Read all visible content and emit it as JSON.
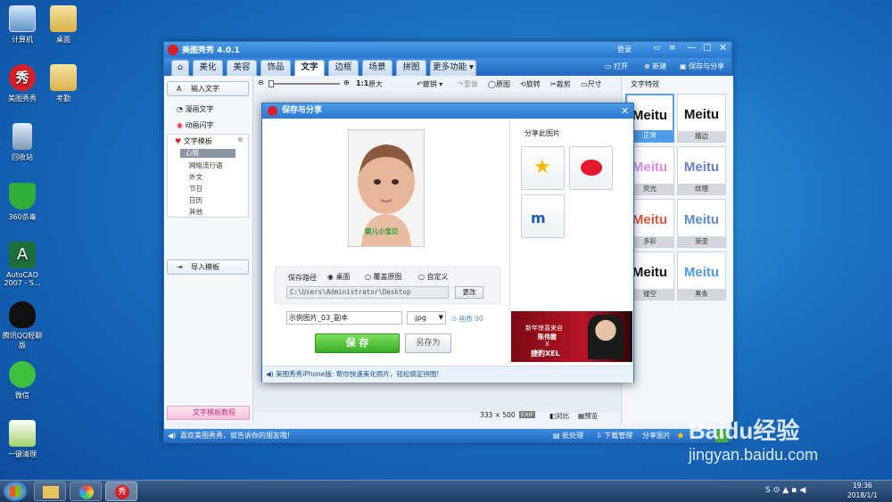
{
  "desktop": {
    "icons": [
      "计算机",
      "桌面",
      "美图秀秀",
      "考勤",
      "回收站",
      "360杀毒",
      "AutoCAD 2007 - S...",
      "腾讯QQ轻聊版",
      "微信",
      "一键清理"
    ]
  },
  "window": {
    "title": "美图秀秀 4.0.1",
    "title_login": "登录",
    "tabs": [
      "美化",
      "美容",
      "饰品",
      "文字",
      "边框",
      "场景",
      "拼图",
      "更多功能"
    ],
    "header_buttons": {
      "open": "打开",
      "new": "新建",
      "save_share": "保存与分享"
    },
    "left": {
      "input_text": "输入文字",
      "comic_text": "漫画文字",
      "animated_text": "动画闪字",
      "template": "文字模板",
      "subitems": [
        "心情",
        "网络流行语",
        "外文",
        "节日",
        "日历",
        "其他"
      ],
      "import_template": "导入模板",
      "tutorial": "文字模板教程"
    },
    "toolbar": {
      "ratio": "1:1",
      "original": "原大",
      "undo": "撤销",
      "redo": "重做",
      "origin_pic": "原图",
      "rotate": "旋转",
      "crop": "裁剪",
      "size": "尺寸"
    },
    "right": {
      "title": "文字特效",
      "effects": [
        {
          "text": "Meitu",
          "label": "正常",
          "color": "#111111"
        },
        {
          "text": "Meitu",
          "label": "描边",
          "color": "#111111"
        },
        {
          "text": "Meitu",
          "label": "荧光",
          "color": "#d88ee0"
        },
        {
          "text": "Meitu",
          "label": "纹理",
          "color": "#6a7fc8"
        },
        {
          "text": "Meitu",
          "label": "多彩",
          "color": "#e0563a"
        },
        {
          "text": "Meitu",
          "label": "渐变",
          "color": "#5a8fd4"
        },
        {
          "text": "Meitu",
          "label": "镂空",
          "color": "#111111"
        },
        {
          "text": "Meitu",
          "label": "黑条",
          "color": "#4f9ae4"
        }
      ]
    },
    "canvas": {
      "dims": "333 × 500",
      "exif": "EXIF",
      "compare": "对比",
      "preview": "预览"
    },
    "status": {
      "left": "喜欢美图秀秀，就告诉你的朋友哦!",
      "batch": "批处理",
      "download": "下载管理",
      "share": "分享图片"
    }
  },
  "dialog": {
    "title": "保存与分享",
    "photo_caption": "婴儿小宝贝",
    "save_path_label": "保存路径",
    "options": [
      "桌面",
      "覆盖原图",
      "自定义"
    ],
    "path_value": "C:\\Users\\Administrator\\Desktop",
    "change": "更改",
    "filename": "示例图片_03_副本",
    "ext": ".jpg",
    "quality_label": "画质",
    "quality": "90",
    "save": "保 存",
    "save_as": "另存为",
    "share_title": "分享此图片",
    "ad_line1": "新年惊喜来自",
    "ad_line2": "陈伟霆",
    "ad_line3": "X",
    "ad_line4": "捷豹XEL",
    "footer": "美图秀秀iPhone版: 帮你快速美化照片，轻松搞定拼图!"
  },
  "taskbar": {
    "time": "19:36",
    "date": "2018/1/1"
  },
  "watermark": {
    "brand": "Baidu经验",
    "url": "jingyan.baidu.com"
  }
}
